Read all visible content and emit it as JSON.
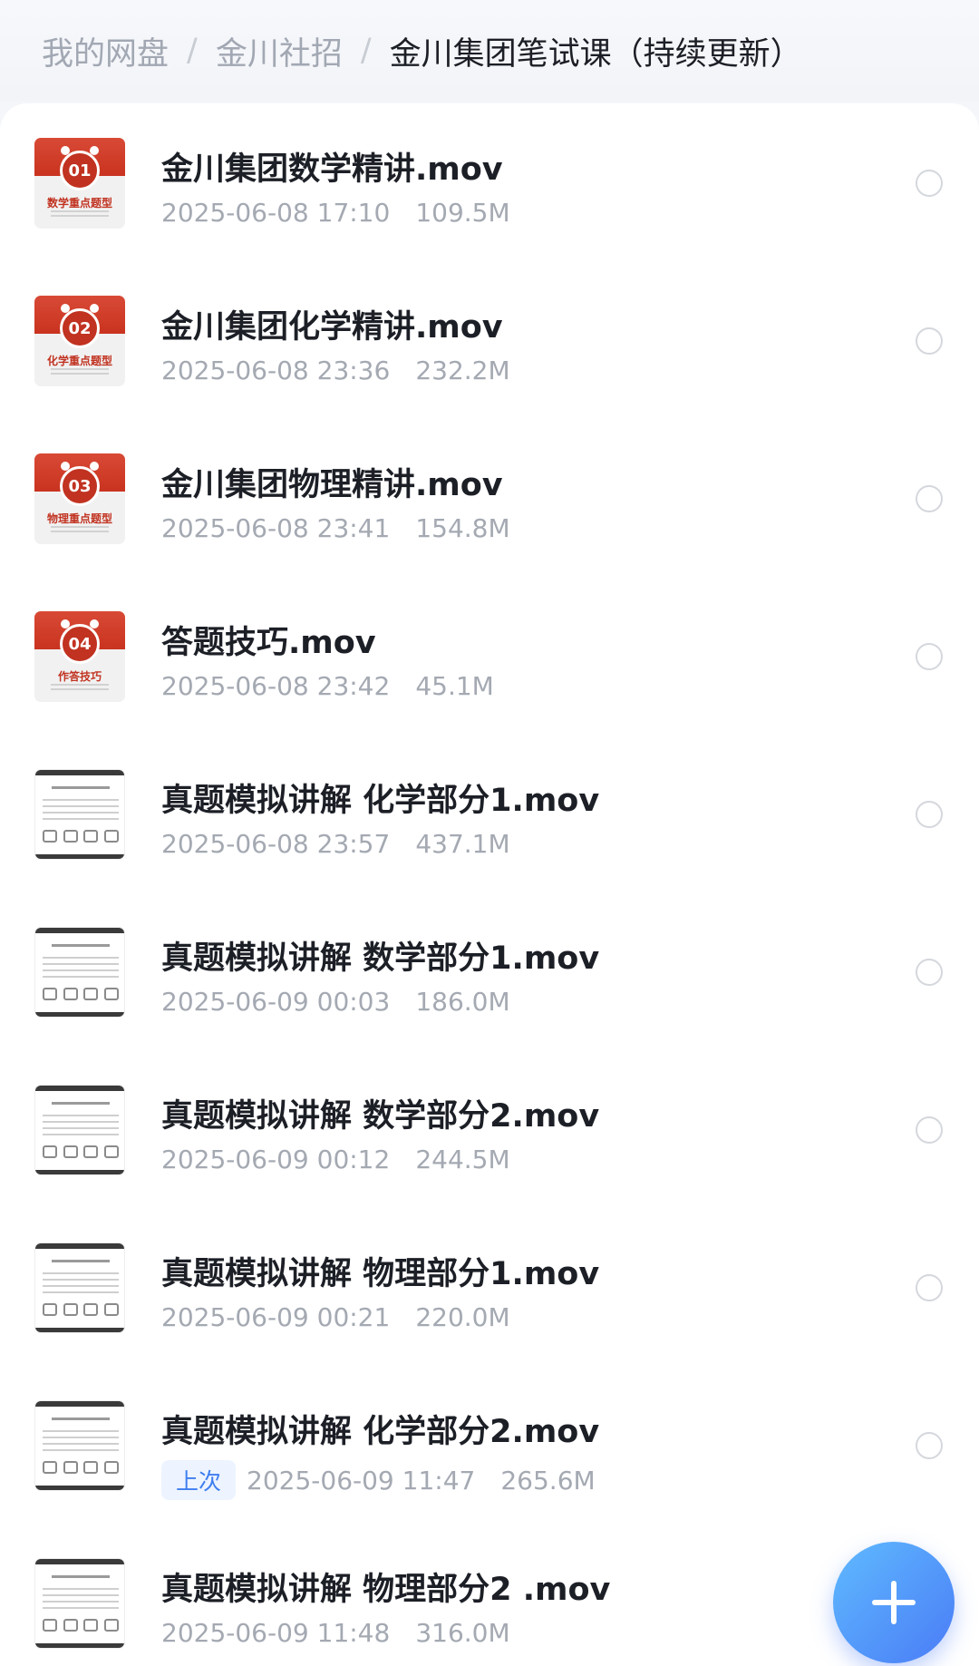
{
  "breadcrumb": {
    "items": [
      "我的网盘",
      "金川社招",
      "金川集团笔试课（持续更新）"
    ],
    "separator": "/"
  },
  "files": [
    {
      "name": "金川集团数学精讲.mov",
      "date": "2025-06-08 17:10",
      "size": "109.5M",
      "thumb": {
        "kind": "red",
        "number": "01",
        "caption": "数学重点题型"
      }
    },
    {
      "name": "金川集团化学精讲.mov",
      "date": "2025-06-08 23:36",
      "size": "232.2M",
      "thumb": {
        "kind": "red",
        "number": "02",
        "caption": "化学重点题型"
      }
    },
    {
      "name": "金川集团物理精讲.mov",
      "date": "2025-06-08 23:41",
      "size": "154.8M",
      "thumb": {
        "kind": "red",
        "number": "03",
        "caption": "物理重点题型"
      }
    },
    {
      "name": "答题技巧.mov",
      "date": "2025-06-08 23:42",
      "size": "45.1M",
      "thumb": {
        "kind": "red",
        "number": "04",
        "caption": "作答技巧"
      }
    },
    {
      "name": "真题模拟讲解 化学部分1.mov",
      "date": "2025-06-08 23:57",
      "size": "437.1M",
      "thumb": {
        "kind": "doc"
      }
    },
    {
      "name": "真题模拟讲解 数学部分1.mov",
      "date": "2025-06-09 00:03",
      "size": "186.0M",
      "thumb": {
        "kind": "doc"
      }
    },
    {
      "name": "真题模拟讲解 数学部分2.mov",
      "date": "2025-06-09 00:12",
      "size": "244.5M",
      "thumb": {
        "kind": "doc"
      }
    },
    {
      "name": "真题模拟讲解 物理部分1.mov",
      "date": "2025-06-09 00:21",
      "size": "220.0M",
      "thumb": {
        "kind": "doc"
      }
    },
    {
      "name": "真题模拟讲解 化学部分2.mov",
      "date": "2025-06-09 11:47",
      "size": "265.6M",
      "tag": "上次",
      "thumb": {
        "kind": "doc"
      }
    },
    {
      "name": "真题模拟讲解 物理部分2 .mov",
      "date": "2025-06-09 11:48",
      "size": "316.0M",
      "thumb": {
        "kind": "doc"
      }
    }
  ],
  "fab": {
    "icon": "plus-icon"
  },
  "colors": {
    "accent": "#4a7cf6",
    "thumb_red": "#c9331f",
    "tag_text": "#3f7ef0",
    "tag_bg": "#edf4ff"
  }
}
